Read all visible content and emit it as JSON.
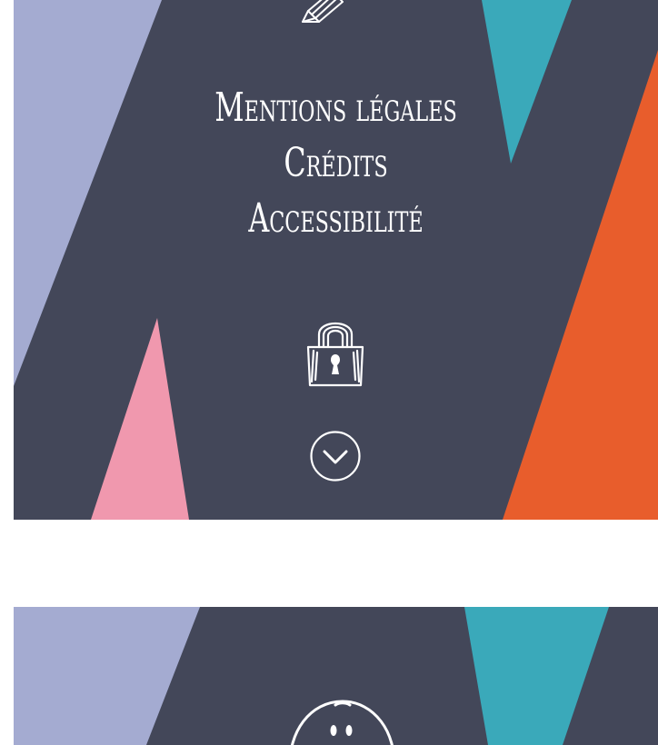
{
  "colors": {
    "background": "#ffffff",
    "panel": "#434759",
    "lavender": "#a4abd1",
    "teal": "#3aa9ba",
    "orange": "#e85d2c",
    "pink": "#f098ae",
    "text": "#ffffff"
  },
  "footer_panel": {
    "links": [
      {
        "label": "Mentions légales"
      },
      {
        "label": "Crédits"
      },
      {
        "label": "Accessibilité"
      }
    ],
    "icons": [
      "pencil-icon",
      "lock-icon",
      "chevron-down-circle-icon"
    ]
  },
  "next_panel": {
    "icons": [
      "smiley-icon"
    ]
  }
}
